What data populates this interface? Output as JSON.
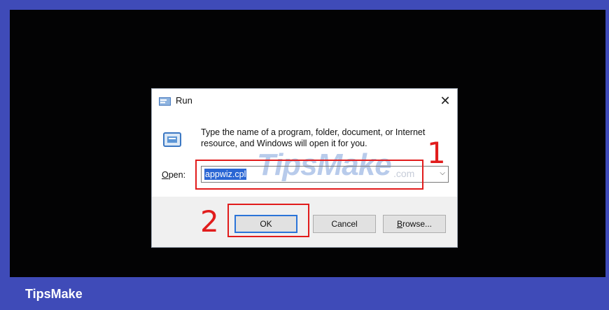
{
  "brand": "TipsMake",
  "dialog": {
    "title": "Run",
    "close_glyph": "✕",
    "description": "Type the name of a program, folder, document, or Internet resource, and Windows will open it for you.",
    "open_label_accel": "O",
    "open_label_rest": "pen:",
    "open_value": "appwiz.cpl",
    "dropdown_glyph": "⌵",
    "buttons": {
      "ok": "OK",
      "cancel": "Cancel",
      "browse_accel": "B",
      "browse_rest": "rowse..."
    }
  },
  "watermark": {
    "text": "TipsMake",
    "domain": ".com"
  },
  "annotations": {
    "step1": "1",
    "step2": "2"
  },
  "colors": {
    "frame": "#3f4bb8",
    "screen": "#030304",
    "highlight": "#e11c1c",
    "selection": "#2a66d4",
    "ok_border": "#2b74d8"
  },
  "icons": {
    "title": "run-app-icon",
    "body": "run-dialog-icon",
    "close": "close-icon",
    "dropdown": "chevron-down-icon"
  }
}
